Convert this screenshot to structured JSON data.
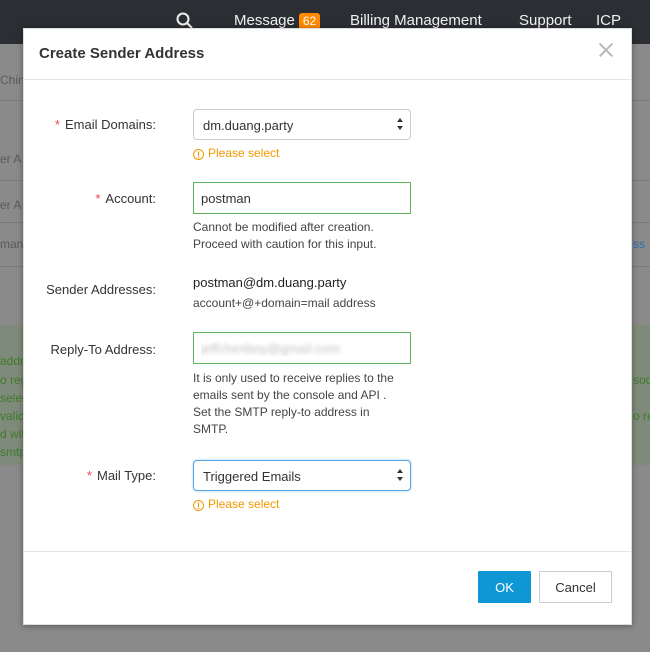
{
  "background": {
    "topnav": {
      "message_label": "Message",
      "message_count": "62",
      "billing": "Billing Management",
      "support": "Support",
      "icp": "ICP"
    },
    "fragments": [
      "China",
      "er A",
      "er A",
      "man@",
      "ss",
      "addr",
      "o reg",
      "selec",
      "valid",
      "d wit",
      "smtp",
      "sod",
      "o reg"
    ]
  },
  "modal": {
    "title": "Create Sender Address",
    "email_domains": {
      "label": "Email Domains:",
      "selected": "dm.duang.party",
      "warning": "Please select"
    },
    "account": {
      "label": "Account:",
      "value": "postman",
      "help_line1": "Cannot be modified after creation.",
      "help_line2": "Proceed with caution for this input."
    },
    "sender_addresses": {
      "label": "Sender Addresses:",
      "value": "postman@dm.duang.party",
      "help": "account+@+domain=mail address"
    },
    "reply_to": {
      "label": "Reply-To Address:",
      "value": "jeffchenboy@gmail.com",
      "help_line1": "It is only used to receive replies to the",
      "help_line2": "emails sent by the console and API .",
      "help_line3": "Set the SMTP reply-to address in",
      "help_line4": "SMTP."
    },
    "mail_type": {
      "label": "Mail Type:",
      "selected": "Triggered Emails",
      "warning": "Please select"
    },
    "required_mark": "*",
    "warning_icon_glyph": "!",
    "ok_label": "OK",
    "cancel_label": "Cancel"
  },
  "colors": {
    "primary": "#0f96d4",
    "warning": "#f39800",
    "required": "#e45",
    "valid_border": "#5fb35f"
  }
}
